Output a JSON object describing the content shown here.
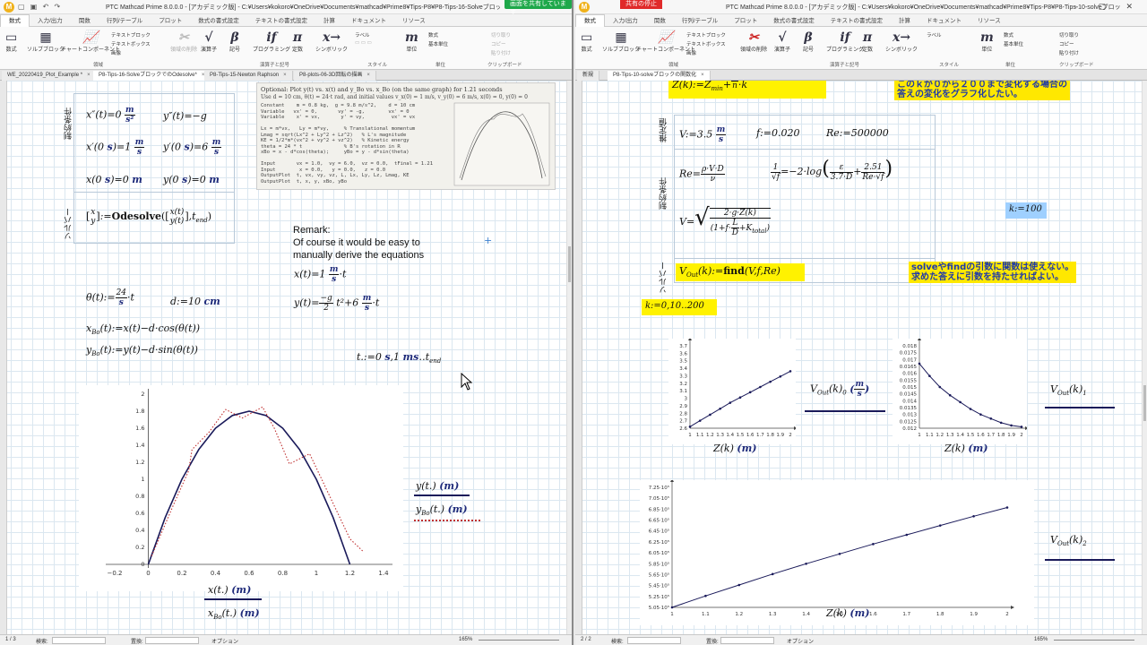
{
  "left": {
    "title": "PTC Mathcad Prime 8.0.0.0 - [アカデミック版] - C:¥Users¥kokoro¥OneDrive¥Documents¥mathcad¥Prime8¥Tips-P8¥P8-Tips-16-SolveブロックでのOdesolve.mcdx",
    "share_banner": "画面を共有しています",
    "ribbon_tabs": [
      "数式",
      "入力/出力",
      "関数",
      "行列/テーブル",
      "プロット",
      "数式の書式設定",
      "テキストの書式設定",
      "計算",
      "ドキュメント",
      "リソース"
    ],
    "ribbon": {
      "math": "数式",
      "solve_block": "ソルブブロック",
      "chart": "チャートコンポーネント",
      "text_block": "テキストブロック",
      "text_box": "テキストボックス",
      "image": "画像",
      "area_delete": "領域の削除",
      "operators": "演算子",
      "symbols": "記号",
      "programming": "プログラミング",
      "constants": "定数",
      "symbolic": "シンボリック",
      "label": "ラベル",
      "unit": "単位",
      "math_label": "数式",
      "basic_unit": "基本単位",
      "cut": "切り取り",
      "copy": "コピー",
      "paste": "貼り付け",
      "group_region": "領域",
      "group_operators": "演算子と記号",
      "group_style": "スタイル",
      "group_units": "単位",
      "group_clipboard": "クリップボード"
    },
    "doc_tabs": [
      "WE_20220419_Plot_Example *",
      "P8-Tips-16-SolveブロックでのOdesolve*",
      "P8-Tips-15-Newton Raphson",
      "P8-plots-06-3D回転の描画"
    ],
    "vlabels": {
      "constraints": "制約条件",
      "solver": "ソルバー"
    },
    "remark_title": "Remark:",
    "remark_body": "Of course it would be easy to\nmanually derive the equations",
    "scan_heading": "Optional: Plot  y(t) vs. x(t)  and  y_Bo vs. x_Bo  (on the same graph) for 1.21 seconds",
    "scan_line2": "Use  d = 10 cm,  θ(t) = 24·t rad,  and initial values  v_x(0) = 1 m/s,  v_y(0) = 6 m/s,  x(0) = 0,  y(0) = 0",
    "scan_code": "Constant    m = 0.8 kg,  g = 9.8 m/s^2,    d = 10 cm\nVariable   vx' = 0,       vy' = -g,        vx' = 0\nVariable    x' = vx,       y' = vy,         vx' = vx\n\nLx = m*vx,   Ly = m*vy,     % Translational momentum\nLmag = sqrt(Lx^2 + Ly^2 + Lz^2)   % L's magnitude\nKE = 1/2*m*(vx^2 + vy^2 + vz^2)   % Kinetic energy\ntheta = 24 * t              % B's rotation in R\nxBo = x - d*cos(theta);     yBo = y - d*sin(theta)\n\nInput       vx = 1.0,  vy = 6.0,  vz = 0.0,  tFinal = 1.21\nInput        x = 0.0,   y = 0.0,   z = 0.0\nOutputPlot  t, vx, vy, vz, L, Lx, Ly, Lz, Lmag, KE\nOutputPlot  t, x, y, xBo, yBo",
    "xaxis_ticks": [
      "−0.2",
      "0",
      "0.2",
      "0.4",
      "0.6",
      "0.8",
      "1",
      "1.2",
      "1.4"
    ],
    "yaxis_ticks": [
      "0",
      "0.2",
      "0.4",
      "0.6",
      "0.8",
      "1",
      "1.2",
      "1.4",
      "1.6",
      "1.8",
      "2"
    ],
    "legend_y1": "y(t.)",
    "legend_y2": "y",
    "legend_y2_sub": "Bo",
    "legend_y2_arg": "(t.)",
    "legend_unit": "(m)",
    "legend_x1": "x(t.)",
    "legend_x2": "x",
    "legend_x2_sub": "Bo",
    "legend_x2_arg": "(t.)",
    "status_page": "1 / 3",
    "status_search": "検索:",
    "status_replace": "置換:",
    "status_options": "オプション",
    "zoom": "165%"
  },
  "right": {
    "title": "PTC Mathcad Prime 8.0.0.0 - [アカデミック版] - C:¥Users¥kokoro¥OneDrive¥Documents¥mathcad¥Prime8¥Tips-P8¥P8-Tips-10-solveブロックの関数化.mcdx",
    "stop_share": "共有の停止",
    "doc_tabs": [
      "新規",
      "P8-Tips-10-solveブロックの関数化"
    ],
    "vlabels": {
      "estimates": "推定値",
      "constraints": "制約条件",
      "solver": "ソルバー"
    },
    "note1": "このｋが０から２００まで変化する場合の\n答えの変化をグラフ化したい。",
    "note2": "solveやfindの引数に関数は使えない。\n求めた答えに引数を持たせればよい。",
    "k_def": "k:=100",
    "k_range": "k:=0,10‥200",
    "p1_yticks": [
      "2.6",
      "2.7",
      "2.8",
      "2.9",
      "3",
      "3.1",
      "3.2",
      "3.3",
      "3.4",
      "3.5",
      "3.6",
      "3.7"
    ],
    "p1_xticks": [
      "1",
      "1.1",
      "1.2",
      "1.3",
      "1.4",
      "1.5",
      "1.6",
      "1.7",
      "1.8",
      "1.9",
      "2"
    ],
    "p2_yticks": [
      "0.012",
      "0.0125",
      "0.013",
      "0.0135",
      "0.014",
      "0.0145",
      "0.015",
      "0.0155",
      "0.016",
      "0.0165",
      "0.017",
      "0.0175",
      "0.018"
    ],
    "p3_yticks": [
      "5.05·10⁵",
      "5.25·10⁵",
      "5.45·10⁵",
      "5.65·10⁵",
      "5.85·10⁵",
      "6.05·10⁵",
      "6.25·10⁵",
      "6.45·10⁵",
      "6.65·10⁵",
      "6.85·10⁵",
      "7.05·10⁵",
      "7.25·10⁵"
    ],
    "zlabel": "Z(k)",
    "zunit": "(m)",
    "vout": "V",
    "vout_sub": "Out",
    "vout_args": [
      "(k)",
      "0",
      "1",
      "2"
    ],
    "vout_unit_top": "m",
    "vout_unit_bot": "s",
    "status_page": "2 / 2",
    "status_search": "検索:",
    "status_replace": "置換:",
    "status_options": "オプション",
    "zoom": "165%"
  },
  "chart_data": [
    {
      "type": "line",
      "name": "left-trajectory",
      "xlim": [
        -0.2,
        1.4
      ],
      "ylim": [
        0,
        2
      ],
      "series": [
        {
          "name": "y(t.) (m)",
          "x": [
            0,
            0.1,
            0.2,
            0.3,
            0.4,
            0.5,
            0.6,
            0.7,
            0.8,
            0.9,
            1.0,
            1.1,
            1.2
          ],
          "y": [
            0,
            0.55,
            1.0,
            1.35,
            1.6,
            1.75,
            1.8,
            1.75,
            1.6,
            1.35,
            1.0,
            0.55,
            0
          ]
        },
        {
          "name": "yBo(t.) (m)",
          "x": [
            0.02,
            0.15,
            0.24,
            0.26,
            0.36,
            0.46,
            0.56,
            0.68,
            0.75,
            0.84,
            0.96,
            1.08,
            1.2,
            1.28
          ],
          "y": [
            0.1,
            0.7,
            1.1,
            1.35,
            1.55,
            1.82,
            1.72,
            1.85,
            1.6,
            1.18,
            1.3,
            0.8,
            0.3,
            0.15
          ]
        }
      ]
    },
    {
      "type": "line",
      "name": "VOut0",
      "xlim": [
        1,
        2
      ],
      "ylim": [
        2.6,
        3.7
      ],
      "x": [
        1,
        1.1,
        1.2,
        1.3,
        1.4,
        1.5,
        1.6,
        1.7,
        1.8,
        1.9,
        2
      ],
      "y": [
        2.62,
        2.7,
        2.78,
        2.86,
        2.94,
        3.01,
        3.08,
        3.15,
        3.22,
        3.29,
        3.36
      ]
    },
    {
      "type": "line",
      "name": "VOut1",
      "xlim": [
        1,
        2
      ],
      "ylim": [
        0.012,
        0.018
      ],
      "x": [
        1,
        1.1,
        1.2,
        1.3,
        1.4,
        1.5,
        1.6,
        1.7,
        1.8,
        1.9,
        2
      ],
      "y": [
        0.0167,
        0.0158,
        0.015,
        0.0144,
        0.0139,
        0.0134,
        0.013,
        0.0127,
        0.0124,
        0.0122,
        0.0121
      ]
    },
    {
      "type": "line",
      "name": "VOut2",
      "xlim": [
        1,
        2
      ],
      "ylim": [
        505000,
        725000
      ],
      "x": [
        1,
        1.1,
        1.2,
        1.3,
        1.4,
        1.5,
        1.6,
        1.7,
        1.8,
        1.9,
        2
      ],
      "y": [
        505000,
        526000,
        546000,
        566000,
        585000,
        603000,
        621000,
        638000,
        655000,
        672000,
        688000
      ]
    }
  ]
}
